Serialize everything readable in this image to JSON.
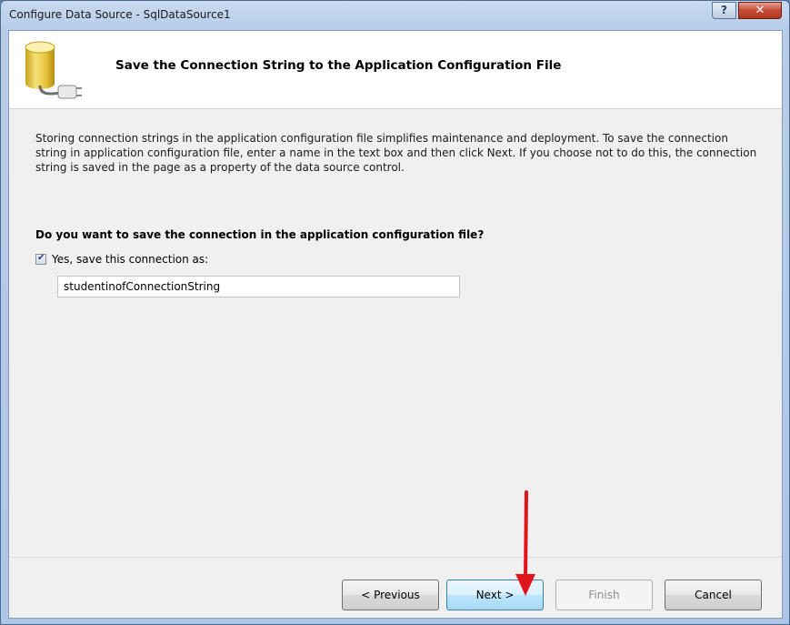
{
  "window": {
    "title": "Configure Data Source - SqlDataSource1",
    "help_label": "?",
    "close_label": "✕"
  },
  "header": {
    "title": "Save the Connection String to the Application Configuration File",
    "icon": "database-plug-icon"
  },
  "content": {
    "description": "Storing connection strings in the application configuration file simplifies maintenance and deployment. To save the connection string in application configuration file, enter a name in the text box and then click Next. If you choose not to do this, the connection string is saved in the page as a property of the data source control.",
    "question": "Do you want to save the connection in the application configuration file?",
    "checkbox_label": "Yes, save this connection as:",
    "checkbox_checked": true,
    "connection_name": "studentinofConnectionString"
  },
  "buttons": {
    "previous": "< Previous",
    "next": "Next >",
    "finish": "Finish",
    "cancel": "Cancel"
  },
  "annotation": {
    "icon": "red-arrow-icon",
    "color": "#e0141b"
  }
}
